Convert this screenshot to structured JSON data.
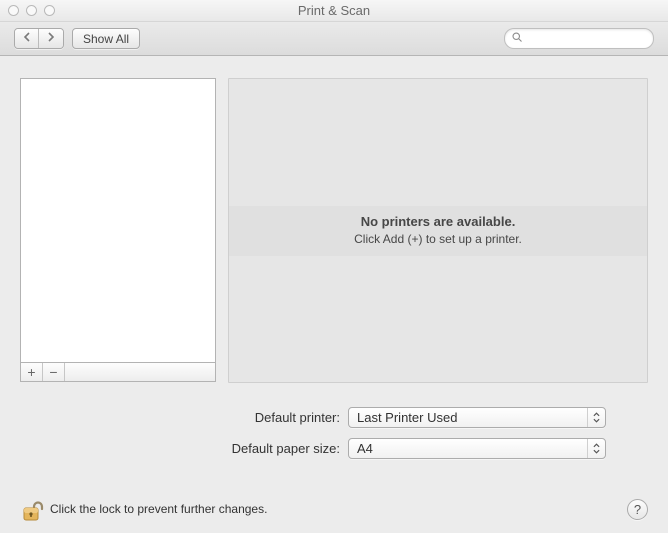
{
  "window": {
    "title": "Print & Scan"
  },
  "toolbar": {
    "show_all_label": "Show All",
    "search_placeholder": ""
  },
  "detail": {
    "line1": "No printers are available.",
    "line2": "Click Add (+) to set up a printer."
  },
  "form": {
    "default_printer_label": "Default printer:",
    "default_printer_value": "Last Printer Used",
    "default_paper_label": "Default paper size:",
    "default_paper_value": "A4"
  },
  "footer": {
    "lock_text": "Click the lock to prevent further changes.",
    "help_label": "?"
  },
  "controls": {
    "add": "+",
    "remove": "−"
  }
}
